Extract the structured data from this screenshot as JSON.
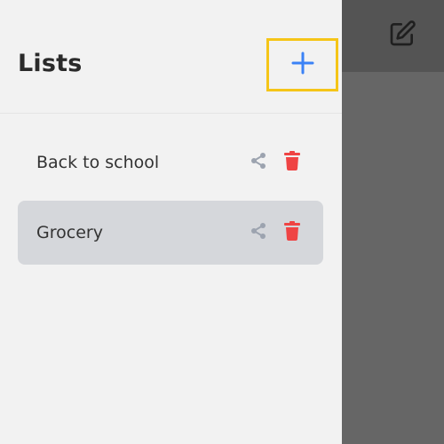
{
  "drawer": {
    "title": "Lists",
    "add_button_icon": "plus-icon",
    "items": [
      {
        "label": "Back to school",
        "selected": false,
        "share_icon": "share-icon",
        "delete_icon": "trash-icon"
      },
      {
        "label": "Grocery",
        "selected": true,
        "share_icon": "share-icon",
        "delete_icon": "trash-icon"
      }
    ]
  },
  "background": {
    "edit_icon": "edit-icon"
  },
  "colors": {
    "accent": "#3b82f6",
    "delete": "#ef4444",
    "share": "#9ca3af",
    "selected_row": "#d5d7db",
    "highlight": "#f5c518"
  }
}
